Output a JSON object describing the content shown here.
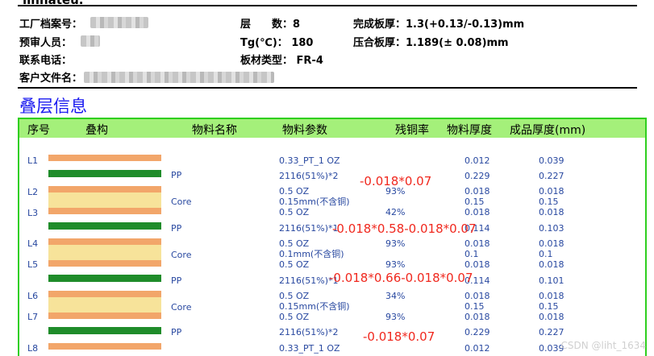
{
  "header": {
    "top_cut_text": "linnateu.",
    "file_no_label": "工厂档案号：",
    "reviewer_label": "预审人员：",
    "phone_label": "联系电话：",
    "customer_file_label": "客户文件名：",
    "layers_label": "层　　数：",
    "layers_value": "8",
    "tg_label": "Tg(℃)：",
    "tg_value": "180",
    "material_label": "板材类型：",
    "material_value": "FR-4",
    "finish_thickness_label": "完成板厚：",
    "finish_thickness_value": "1.3(+0.13/-0.13)mm",
    "press_thickness_label": "压合板厚：",
    "press_thickness_value": "1.189(± 0.08)mm"
  },
  "section_title": "叠层信息",
  "table": {
    "columns": [
      "序号",
      "叠构",
      "物料名称",
      "物料参数",
      "残铜率",
      "物料厚度",
      "成品厚度(mm)"
    ],
    "rows": [
      {
        "label": "L1",
        "material": "",
        "param": "0.33_PT_1 OZ",
        "cu": "",
        "thickness": "0.012",
        "finished": "0.039"
      },
      {
        "label": "",
        "material": "PP",
        "param": "2116(51%)*2",
        "cu": "",
        "thickness": "0.229",
        "finished": "0.227"
      },
      {
        "label": "L2",
        "material": "",
        "param": "0.5 OZ",
        "cu": "93%",
        "thickness": "0.018",
        "finished": "0.018"
      },
      {
        "label": "",
        "material": "Core",
        "param": "0.15mm(不含铜)",
        "cu": "",
        "thickness": "0.15",
        "finished": "0.15"
      },
      {
        "label": "L3",
        "material": "",
        "param": "0.5 OZ",
        "cu": "42%",
        "thickness": "0.018",
        "finished": "0.018"
      },
      {
        "label": "",
        "material": "PP",
        "param": "2116(51%)*1",
        "cu": "",
        "thickness": "0.114",
        "finished": "0.103"
      },
      {
        "label": "L4",
        "material": "",
        "param": "0.5 OZ",
        "cu": "93%",
        "thickness": "0.018",
        "finished": "0.018"
      },
      {
        "label": "",
        "material": "Core",
        "param": "0.1mm(不含铜)",
        "cu": "",
        "thickness": "0.1",
        "finished": "0.1"
      },
      {
        "label": "L5",
        "material": "",
        "param": "0.5 OZ",
        "cu": "93%",
        "thickness": "0.018",
        "finished": "0.018"
      },
      {
        "label": "",
        "material": "PP",
        "param": "2116(51%)*1",
        "cu": "",
        "thickness": "0.114",
        "finished": "0.101"
      },
      {
        "label": "L6",
        "material": "",
        "param": "0.5 OZ",
        "cu": "34%",
        "thickness": "0.018",
        "finished": "0.018"
      },
      {
        "label": "",
        "material": "Core",
        "param": "0.15mm(不含铜)",
        "cu": "",
        "thickness": "0.15",
        "finished": "0.15"
      },
      {
        "label": "L7",
        "material": "",
        "param": "0.5 OZ",
        "cu": "93%",
        "thickness": "0.018",
        "finished": "0.018"
      },
      {
        "label": "",
        "material": "PP",
        "param": "2116(51%)*2",
        "cu": "",
        "thickness": "0.229",
        "finished": "0.227"
      },
      {
        "label": "L8",
        "material": "",
        "param": "0.33_PT_1 OZ",
        "cu": "",
        "thickness": "0.012",
        "finished": "0.039"
      }
    ]
  },
  "annotations": [
    "-0.018*0.07",
    "-0.018*0.58-0.018*0.07",
    "-0.018*0.66-0.018*0.07",
    "-0.018*0.07"
  ],
  "watermark": "CSDN @liht_1634",
  "colors": {
    "title_blue": "#1a1af0",
    "table_border": "#2fcf1f",
    "table_header_bg": "#a4f07a",
    "copper": "#f2a66a",
    "prepreg": "#1f8c2a",
    "core": "#f7e39a",
    "cell_text": "#2848a0",
    "annotation_red": "#f0281e"
  }
}
